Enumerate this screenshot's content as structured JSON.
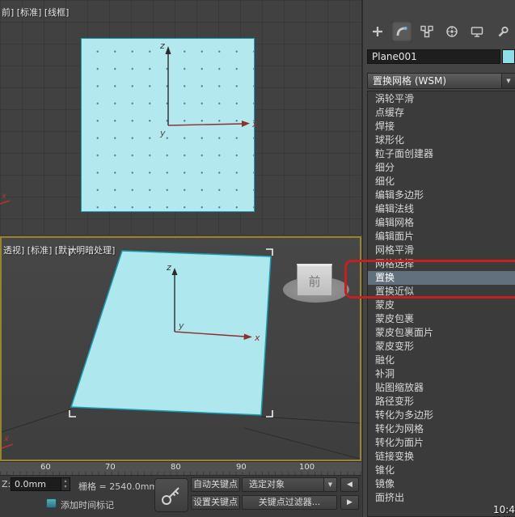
{
  "viewport_front": {
    "label": "前] [标准] [线框]",
    "axis_labels": {
      "x": "x",
      "y": "y",
      "z": "z"
    }
  },
  "viewport_perspective": {
    "label": "透视] [标准] [默认明暗处理]",
    "axis_labels": {
      "x": "x",
      "y": "y",
      "z": "z"
    },
    "viewcube_face": "前"
  },
  "command_panel": {
    "tabs": [
      "create",
      "modify",
      "hierarchy",
      "motion",
      "display",
      "utilities"
    ],
    "active_tab": "modify",
    "object_name": "Plane001",
    "object_color": "#8fdde9",
    "modifier_selector_value": "置换网格 (WSM)",
    "modifier_list": {
      "items": [
        "涡轮平滑",
        "点缓存",
        "焊接",
        "球形化",
        "粒子面创建器",
        "细分",
        "细化",
        "编辑多边形",
        "编辑法线",
        "编辑网格",
        "编辑面片",
        "网格平滑",
        "网格选择",
        "置换",
        "置换近似",
        "蒙皮",
        "蒙皮包裹",
        "蒙皮包裹面片",
        "蒙皮变形",
        "融化",
        "补洞",
        "贴图缩放器",
        "路径变形",
        "转化为多边形",
        "转化为网格",
        "转化为面片",
        "链接变换",
        "锥化",
        "镜像",
        "面挤出"
      ],
      "selected": "置换",
      "selected_index": 13
    }
  },
  "trackbar": {
    "ticks": [
      "60",
      "70",
      "80",
      "90",
      "100"
    ]
  },
  "status_bar": {
    "z_label": "Z:",
    "z_value": "0.0mm",
    "grid_readout": "栅格 = 2540.0mm",
    "add_time_tag": "添加时间标记",
    "auto_key": "自动关键点",
    "selection_set": "选定对象",
    "set_key": "设置关键点",
    "key_filters": "关键点过滤器...",
    "prev_icon": "◀",
    "next_icon": "▶",
    "spinner_up": "▴",
    "spinner_down": "▾"
  },
  "overlay": {
    "timestamp": "10:4",
    "annotation_color": "#c32020"
  },
  "icons": {
    "dropdown_arrow": "▼"
  }
}
